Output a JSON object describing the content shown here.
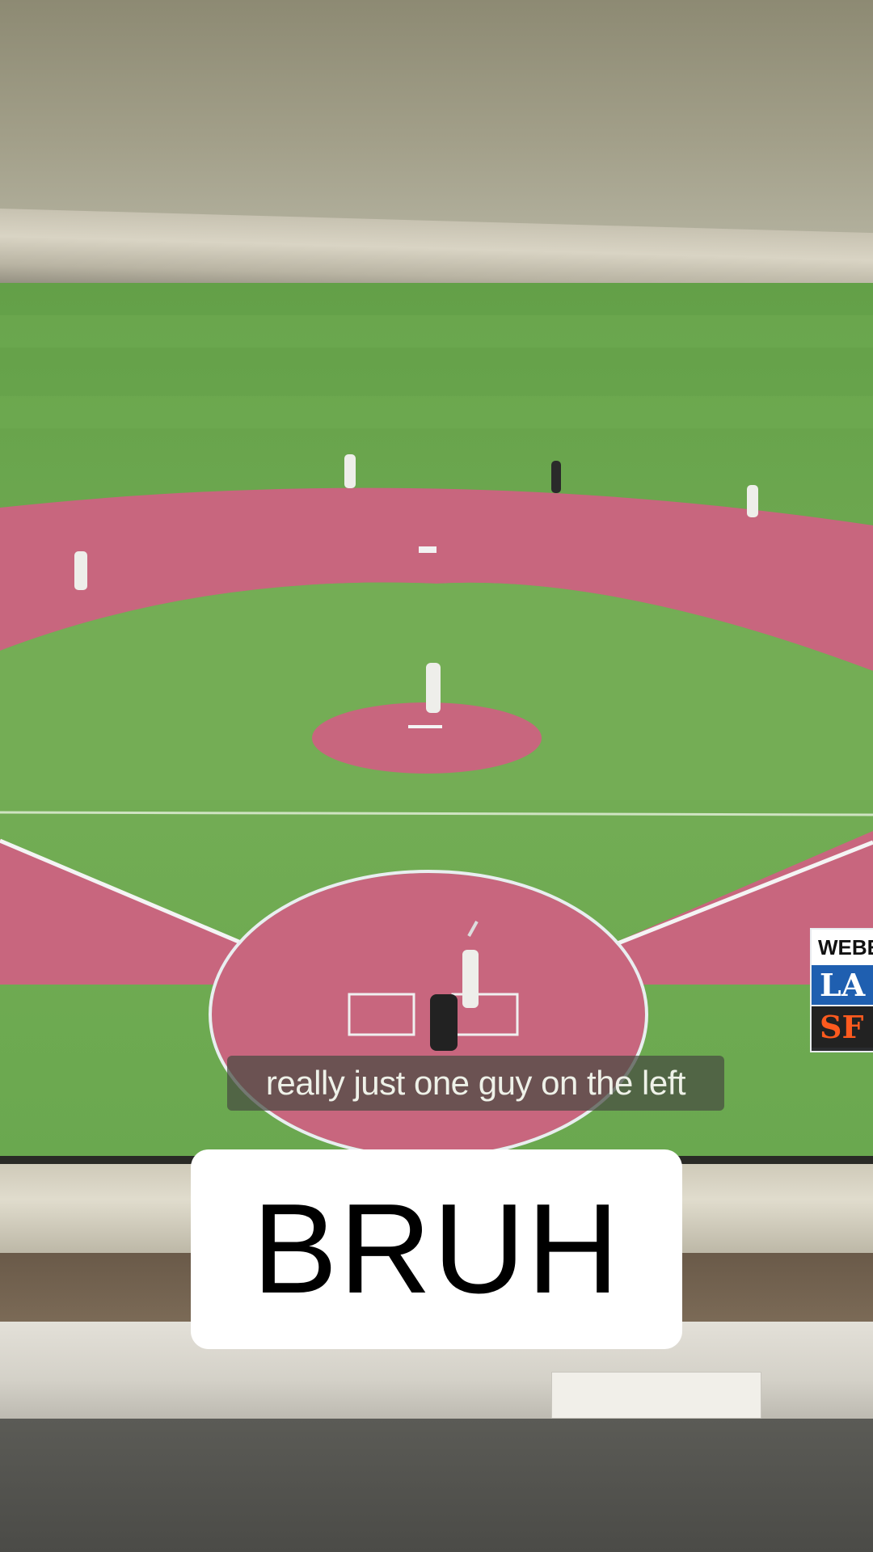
{
  "broadcast": {
    "caption": "really just one guy on the left",
    "scorebug": {
      "player": "WEBE",
      "teams": [
        {
          "logo": "LA",
          "color": "#1f5fb0"
        },
        {
          "logo": "SF",
          "color": "#fd5a1e"
        }
      ]
    }
  },
  "overlay": {
    "text": "BRUH"
  },
  "colors": {
    "grass": "#6da64f",
    "dirt": "#c8667e",
    "overlay_bg": "#ffffff",
    "overlay_text": "#000000"
  }
}
